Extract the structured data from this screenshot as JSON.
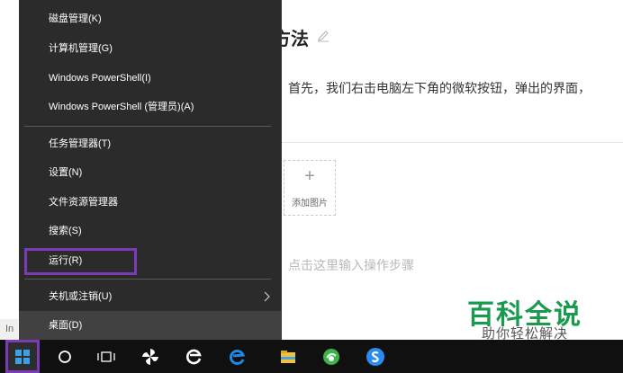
{
  "article": {
    "title": "方法",
    "step_text": "首先，我们右击电脑左下角的微软按钮，弹出的界面，",
    "add_image_label": "添加图片",
    "add_image_plus": "+",
    "input_placeholder": "点击这里输入操作步骤",
    "left_strip_text": "In"
  },
  "context_menu": {
    "items": [
      {
        "label": "磁盘管理(K)"
      },
      {
        "label": "计算机管理(G)"
      },
      {
        "label": "Windows PowerShell(I)"
      },
      {
        "label": "Windows PowerShell (管理员)(A)"
      },
      {
        "label": "任务管理器(T)"
      },
      {
        "label": "设置(N)"
      },
      {
        "label": "文件资源管理器"
      },
      {
        "label": "搜索(S)"
      },
      {
        "label": "运行(R)"
      },
      {
        "label": "关机或注销(U)"
      },
      {
        "label": "桌面(D)"
      }
    ],
    "highlight_color": "#7a3bb5"
  },
  "watermark": {
    "main": "百科全说",
    "sub": "助你轻松解决",
    "color": "#1a9a4e"
  },
  "taskbar": {
    "icons": [
      "windows-start-icon",
      "cortana-search-icon",
      "task-view-icon",
      "pinwheel-app-icon",
      "ie-icon",
      "edge-icon",
      "file-explorer-icon",
      "green-browser-icon",
      "sogou-icon"
    ]
  }
}
